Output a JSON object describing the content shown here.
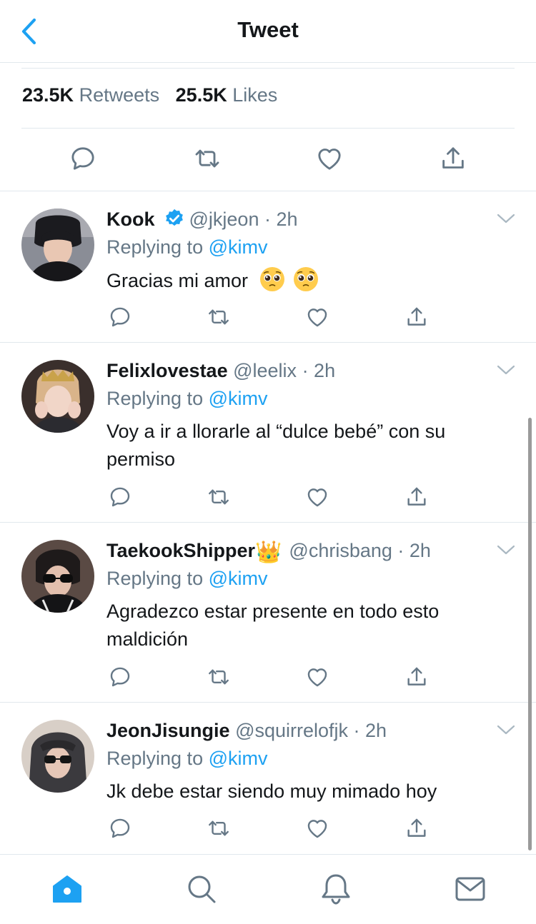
{
  "header": {
    "title": "Tweet"
  },
  "stats": {
    "retweets_count": "23.5K",
    "retweets_label": "Retweets",
    "likes_count": "25.5K",
    "likes_label": "Likes"
  },
  "replying_label": "Replying to",
  "replies": [
    {
      "name": "Kook",
      "verified": true,
      "handle": "@jkjeon",
      "time": "· 2h",
      "mention": "@kimv",
      "text": "Gracias mi amor",
      "emojis": [
        "pleading-face",
        "pleading-face"
      ]
    },
    {
      "name": "Felixlovestae",
      "handle": "@leelix",
      "time": "· 2h",
      "mention": "@kimv",
      "text": "Voy a ir a llorarle al “dulce bebé” con su permiso"
    },
    {
      "name": "TaekookShipper",
      "name_emoji": "👑",
      "handle": "@chrisbang",
      "time": "· 2h",
      "mention": "@kimv",
      "text": "Agradezco estar presente en todo esto maldición"
    },
    {
      "name": "JeonJisungie",
      "handle": "@squirrelofjk",
      "time": "· 2h",
      "mention": "@kimv",
      "text": "Jk debe estar siendo muy mimado hoy"
    }
  ],
  "icons": {
    "back": "chevron-left-icon",
    "reply": "comment-icon",
    "retweet": "retweet-icon",
    "like": "heart-icon",
    "share": "share-icon",
    "caret": "chevron-down-icon",
    "verified": "verified-badge-icon",
    "tabs": [
      "home-icon",
      "search-icon",
      "notifications-icon",
      "messages-icon"
    ]
  },
  "colors": {
    "accent": "#1da1f2",
    "text": "#14171a",
    "muted": "#657786",
    "divider": "#e1e8ed"
  }
}
